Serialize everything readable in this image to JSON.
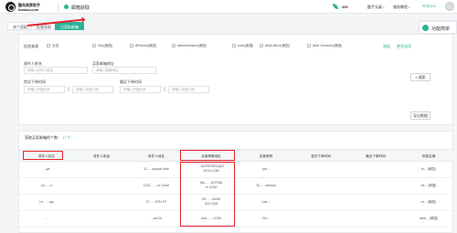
{
  "app": {
    "brand_name": "酷鸟卖家助手",
    "brand_domain": "kuniao.com",
    "module_title": "邮箱获取",
    "points": "390",
    "user_menu": "酷手无敌",
    "service_menu": "服务教程",
    "lang_badge": "中文/EN"
  },
  "side_widget": {
    "label": "功能简单"
  },
  "tabs": [
    {
      "label": "单个获取"
    },
    {
      "label": "批量获取"
    },
    {
      "label": "已获取邮箱"
    }
  ],
  "filters": {
    "source_label": "信息来源",
    "options": [
      {
        "label": "全选"
      },
      {
        "label": "Silly(美国)"
      },
      {
        "label": "8PWorld(美国)"
      },
      {
        "label": "alllovestickers(美国)"
      },
      {
        "label": "ooflo(美国)"
      },
      {
        "label": "ABAUNDA(美国)"
      },
      {
        "label": "Abel Osorrello(美国)"
      }
    ],
    "collapse_link": "收起",
    "more_link": "更多选项",
    "buyer_name_label": "收件人姓名",
    "buyer_name_placeholder": "请输入收件人姓名",
    "email_label": "买家邮箱地址",
    "email_placeholder": "请输入邮箱地址",
    "search_button": "搜索",
    "first_order_label": "首次下单时间",
    "last_order_label": "最近下单时间",
    "start_placeholder": "请输入开始时间",
    "end_placeholder": "请输入结束时间",
    "range_sep": "至",
    "export_button": "导出数据"
  },
  "table": {
    "title": "获取买家邮箱的个数：",
    "count": "17 个",
    "columns": [
      "收件人姓名",
      "收件人电话",
      "收件人地址",
      "买家邮箱地址",
      "买家昵称",
      "首次下单时间",
      "最近下单时间",
      "所属店铺"
    ],
    "rows": [
      {
        "name": "...ya",
        "phone": "",
        "address": "12 ... canyon lane",
        "email": "...SUPERDEA@G\nHOO.COM",
        "nickname": "par...",
        "first": "",
        "last": "",
        "shop": "ei... (美国)"
      },
      {
        "name": "La... ...n",
        "phone": "",
        "address": "1120 ... ...er Circle",
        "email": "MA... ...HOTMA\nIL.COM",
        "nickname": "Ta... ...ahnson",
        "first": "",
        "last": "",
        "shop": "eit... (美国)"
      },
      {
        "name": "Le... ...rge",
        "phone": "",
        "address": "27... ...8TH ST",
        "email": "GE... ...AYAH\nOO.COM",
        "nickname": "Lois ...",
        "first": "",
        "last": "",
        "shop": "ei... (美国)"
      },
      {
        "name": "...",
        "phone": "",
        "address": "...ath Dr",
        "email": "AAL... ...COM",
        "nickname": "Rit...",
        "first": "",
        "last": "",
        "shop": "rabb... (美国)"
      }
    ]
  }
}
